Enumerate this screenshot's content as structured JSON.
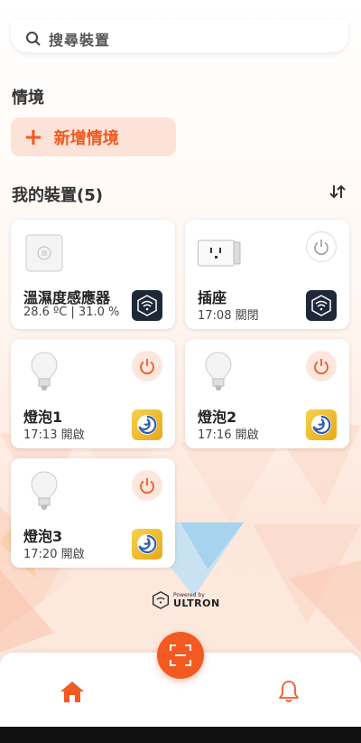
{
  "search": {
    "placeholder": "搜尋裝置"
  },
  "scenes": {
    "title": "情境",
    "add_label": "新增情境"
  },
  "devices": {
    "title": "我的裝置(5)",
    "items": [
      {
        "name": "溫濕度感應器",
        "status": "28.6 ºC | 31.0 %",
        "type": "sensor",
        "power": "none",
        "brand": "wifi-hex"
      },
      {
        "name": "插座",
        "status": "17:08 關閉",
        "type": "plug",
        "power": "off",
        "brand": "wifi-hex"
      },
      {
        "name": "燈泡1",
        "status": "17:13 開啟",
        "type": "bulb",
        "power": "on",
        "brand": "swirl"
      },
      {
        "name": "燈泡2",
        "status": "17:16 開啟",
        "type": "bulb",
        "power": "on",
        "brand": "swirl"
      },
      {
        "name": "燈泡3",
        "status": "17:20 開啟",
        "type": "bulb",
        "power": "on",
        "brand": "swirl"
      }
    ]
  },
  "footer": {
    "powered_by": "Powered by",
    "brand": "ULTRON"
  },
  "nav": {
    "items": [
      "home-icon",
      "bell-icon"
    ],
    "active": "home-icon"
  },
  "colors": {
    "accent": "#f25a22",
    "accent_light": "#fde2d8",
    "brand_dark": "#1e2838",
    "brand_gold": "#e8a917"
  }
}
